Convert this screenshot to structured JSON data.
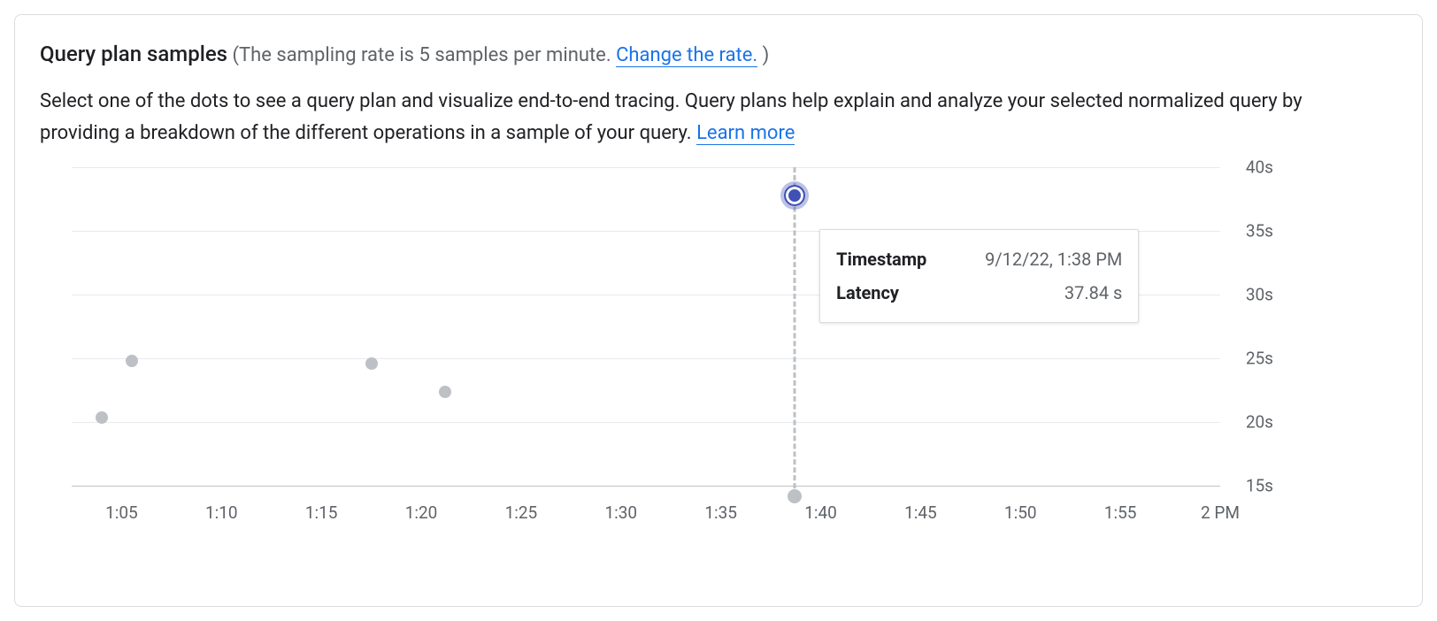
{
  "header": {
    "title": "Query plan samples",
    "subtitle_prefix": "(The sampling rate is 5 samples per minute. ",
    "change_rate_link": "Change the rate.",
    "subtitle_suffix": " )"
  },
  "description": {
    "text": "Select one of the dots to see a query plan and visualize end-to-end tracing. Query plans help explain and analyze your selected normalized query by providing a breakdown of the different operations in a sample of your query. ",
    "learn_more": "Learn more"
  },
  "tooltip": {
    "timestamp_label": "Timestamp",
    "timestamp_value": "9/12/22, 1:38 PM",
    "latency_label": "Latency",
    "latency_value": "37.84 s"
  },
  "chart_data": {
    "type": "scatter",
    "xlabel": "",
    "ylabel": "",
    "x_ticks": [
      "1:05",
      "1:10",
      "1:15",
      "1:20",
      "1:25",
      "1:30",
      "1:35",
      "1:40",
      "1:45",
      "1:50",
      "1:55",
      "2 PM"
    ],
    "y_ticks": [
      "15s",
      "20s",
      "25s",
      "30s",
      "35s",
      "40s"
    ],
    "ylim": [
      15,
      40
    ],
    "xlim_minutes": [
      62.5,
      120
    ],
    "vline_x_minute": 98.7,
    "points": [
      {
        "time_label": "1:04",
        "x_minute": 64.0,
        "latency_s": 20.4,
        "selected": false
      },
      {
        "time_label": "1:05",
        "x_minute": 65.5,
        "latency_s": 24.8,
        "selected": false
      },
      {
        "time_label": "1:17",
        "x_minute": 77.5,
        "latency_s": 24.6,
        "selected": false
      },
      {
        "time_label": "1:21",
        "x_minute": 81.2,
        "latency_s": 22.4,
        "selected": false
      },
      {
        "time_label": "1:38",
        "x_minute": 98.7,
        "latency_s": 37.84,
        "selected": true
      }
    ]
  }
}
